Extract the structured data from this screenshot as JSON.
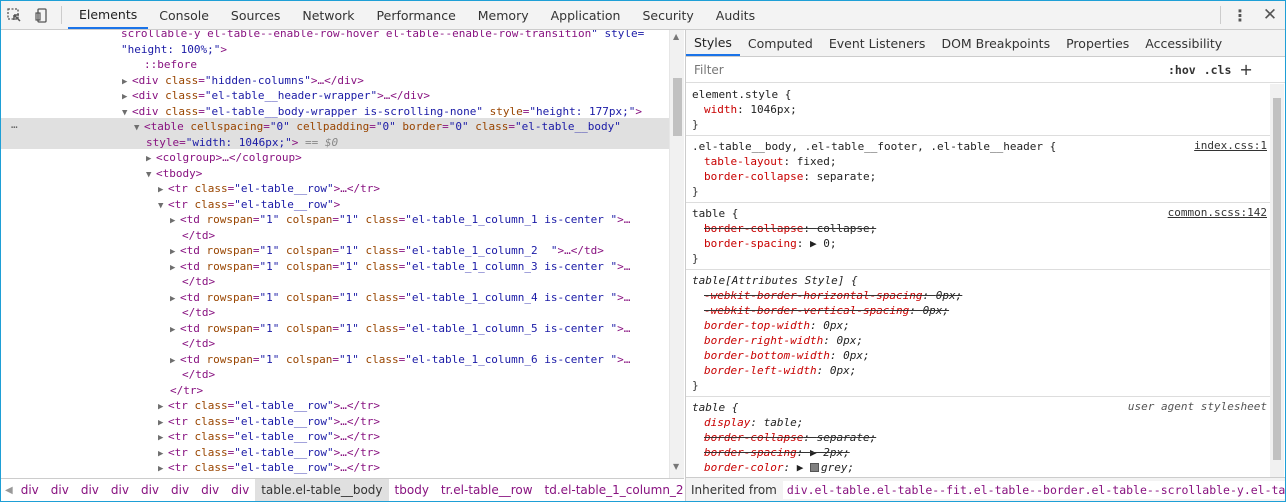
{
  "toolbar": {
    "tabs": [
      "Elements",
      "Console",
      "Sources",
      "Network",
      "Performance",
      "Memory",
      "Application",
      "Security",
      "Audits"
    ],
    "active_tab": "Elements"
  },
  "elements": {
    "lines": [
      {
        "t": "scrollable-y el-table--enable-row-hover el-table--enable-row-transition\" style=",
        "indent": 120
      },
      {
        "t": "\"height: 100%;\">",
        "indent": 120
      },
      {
        "t": "::before",
        "indent": 143
      },
      {
        "t": "<div class=\"hidden-columns\">…</div>",
        "indent": 133,
        "tri": "▶"
      },
      {
        "t": "<div class=\"el-table__header-wrapper\">…</div>",
        "indent": 133,
        "tri": "▶"
      },
      {
        "t": "<div class=\"el-table__body-wrapper is-scrolling-none\" style=\"height: 177px;\">",
        "indent": 133,
        "tri": "▼"
      },
      {
        "t": "<table cellspacing=\"0\" cellpadding=\"0\" border=\"0\" class=\"el-table__body\"",
        "indent": 145,
        "tri": "▼"
      },
      {
        "t": "style=\"width: 1046px;\"> == $0",
        "indent": 145
      },
      {
        "t": "<colgroup>…</colgroup>",
        "indent": 157,
        "tri": "▶"
      },
      {
        "t": "<tbody>",
        "indent": 157,
        "tri": "▼"
      },
      {
        "t": "<tr class=\"el-table__row\">…</tr>",
        "indent": 169,
        "tri": "▶"
      },
      {
        "t": "<tr class=\"el-table__row\">",
        "indent": 169,
        "tri": "▼"
      },
      {
        "t": "<td rowspan=\"1\" colspan=\"1\" class=\"el-table_1_column_1 is-center \">…",
        "indent": 181,
        "tri": "▶"
      },
      {
        "t": "</td>",
        "indent": 181
      },
      {
        "t": "<td rowspan=\"1\" colspan=\"1\" class=\"el-table_1_column_2  \">…</td>",
        "indent": 181,
        "tri": "▶"
      },
      {
        "t": "<td rowspan=\"1\" colspan=\"1\" class=\"el-table_1_column_3 is-center \">…",
        "indent": 181,
        "tri": "▶"
      },
      {
        "t": "</td>",
        "indent": 181
      },
      {
        "t": "<td rowspan=\"1\" colspan=\"1\" class=\"el-table_1_column_4 is-center \">…",
        "indent": 181,
        "tri": "▶"
      },
      {
        "t": "</td>",
        "indent": 181
      },
      {
        "t": "<td rowspan=\"1\" colspan=\"1\" class=\"el-table_1_column_5 is-center \">…",
        "indent": 181,
        "tri": "▶"
      },
      {
        "t": "</td>",
        "indent": 181
      },
      {
        "t": "<td rowspan=\"1\" colspan=\"1\" class=\"el-table_1_column_6 is-center \">…",
        "indent": 181,
        "tri": "▶"
      },
      {
        "t": "</td>",
        "indent": 181
      },
      {
        "t": "</tr>",
        "indent": 169
      },
      {
        "t": "<tr class=\"el-table__row\">…</tr>",
        "indent": 169,
        "tri": "▶"
      },
      {
        "t": "<tr class=\"el-table__row\">…</tr>",
        "indent": 169,
        "tri": "▶"
      },
      {
        "t": "<tr class=\"el-table__row\">…</tr>",
        "indent": 169,
        "tri": "▶"
      },
      {
        "t": "<tr class=\"el-table__row\">…</tr>",
        "indent": 169,
        "tri": "▶"
      },
      {
        "t": "<tr class=\"el-table__row\">…</tr>",
        "indent": 169,
        "tri": "▶"
      }
    ],
    "ellipsis": "…"
  },
  "breadcrumbs": [
    "div",
    "div",
    "div",
    "div",
    "div",
    "div",
    "div",
    "div",
    "table.el-table__body",
    "tbody",
    "tr.el-table__row",
    "td.el-table_1_column_2"
  ],
  "breadcrumb_selected": "table.el-table__body",
  "styles": {
    "subtabs": [
      "Styles",
      "Computed",
      "Event Listeners",
      "DOM Breakpoints",
      "Properties",
      "Accessibility"
    ],
    "active_subtab": "Styles",
    "filter_placeholder": "Filter",
    "hov": ":hov",
    "cls": ".cls",
    "rules": [
      {
        "selector": "element.style {",
        "source": "",
        "props": [
          {
            "n": "width",
            "v": "1046px;"
          }
        ],
        "close": "}"
      },
      {
        "selector": ".el-table__body, .el-table__footer, .el-table__header {",
        "source": "index.css:1",
        "props": [
          {
            "n": "table-layout",
            "v": "fixed;"
          },
          {
            "n": "border-collapse",
            "v": "separate;"
          }
        ],
        "close": "}"
      },
      {
        "selector": "table {",
        "source": "common.scss:142",
        "props": [
          {
            "n": "border-collapse",
            "v": "collapse;",
            "strike": true
          },
          {
            "n": "border-spacing",
            "v": "▶ 0;"
          }
        ],
        "close": "}"
      },
      {
        "selector": "table[Attributes Style] {",
        "source": "",
        "italic": true,
        "props": [
          {
            "n": "-webkit-border-horizontal-spacing",
            "v": "0px;",
            "strike": true
          },
          {
            "n": "-webkit-border-vertical-spacing",
            "v": "0px;",
            "strike": true
          },
          {
            "n": "border-top-width",
            "v": "0px;"
          },
          {
            "n": "border-right-width",
            "v": "0px;"
          },
          {
            "n": "border-bottom-width",
            "v": "0px;"
          },
          {
            "n": "border-left-width",
            "v": "0px;"
          }
        ],
        "close": "}"
      },
      {
        "selector": "table {",
        "source": "user agent stylesheet",
        "ua": true,
        "props": [
          {
            "n": "display",
            "v": "table;"
          },
          {
            "n": "border-collapse",
            "v": "separate;",
            "strike": true
          },
          {
            "n": "border-spacing",
            "v": "▶ 2px;",
            "strike": true
          },
          {
            "n": "border-color",
            "v": "▶ grey;",
            "swatch": true
          }
        ],
        "close": "}"
      }
    ],
    "inherited_label": "Inherited from",
    "inherited_chain": "div.el-table.el-table--fit.el-table--border.el-table--scrollable-y.el-ta…"
  },
  "colors": {
    "accent": "#1a73e8",
    "tag": "#881280",
    "attr": "#994500",
    "value": "#1a1aa6",
    "prop": "#c80000",
    "selection": "#e0e0e0"
  }
}
